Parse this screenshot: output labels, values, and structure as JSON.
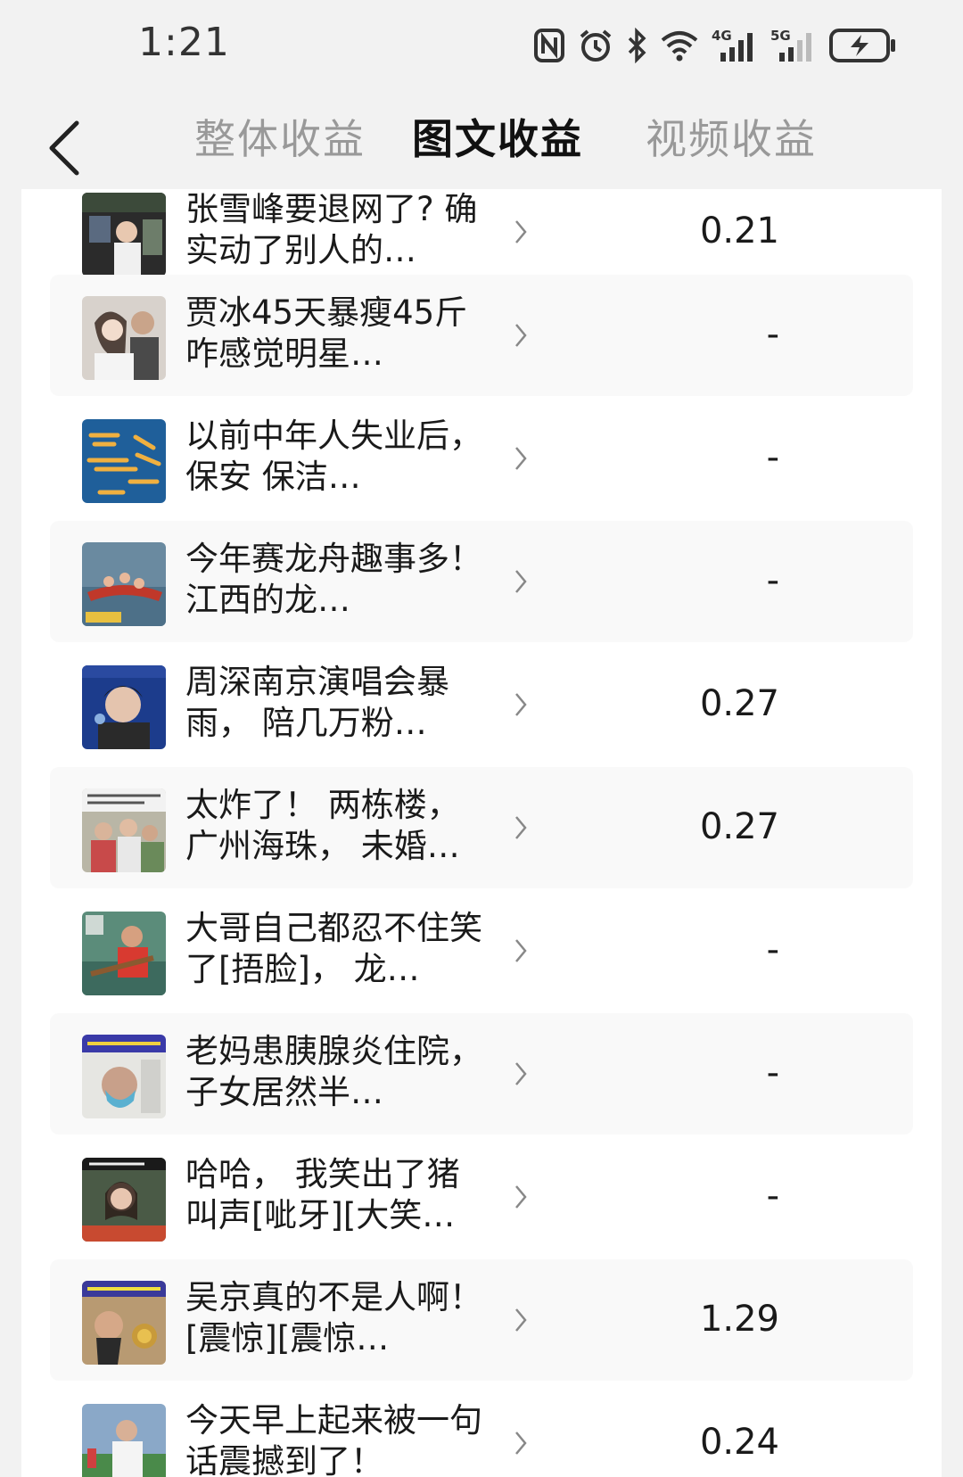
{
  "status_bar": {
    "time": "1:21",
    "icons": [
      "nfc-icon",
      "alarm-icon",
      "bluetooth-icon",
      "wifi-icon",
      "signal-4g-icon",
      "signal-5g-icon",
      "battery-charging-icon"
    ],
    "network_labels": {
      "first": "4G",
      "second": "5G"
    }
  },
  "header": {
    "back_icon": "chevron-left-icon",
    "tabs": [
      {
        "label": "整体收益",
        "active": false
      },
      {
        "label": "图文收益",
        "active": true
      },
      {
        "label": "视频收益",
        "active": false
      }
    ]
  },
  "colors": {
    "background": "#f2f2f2",
    "panel": "#ffffff",
    "tab_inactive": "#999999",
    "tab_active": "#111111"
  },
  "articles": [
    {
      "title": "张雪峰要退网了? 确实动了别人的…",
      "value": "0.21"
    },
    {
      "title": "贾冰45天暴瘦45斤 咋感觉明星…",
      "value": "-"
    },
    {
      "title": "以前中年人失业后， 保安 保洁…",
      "value": "-"
    },
    {
      "title": "今年赛龙舟趣事多！ 江西的龙…",
      "value": "-"
    },
    {
      "title": "周深南京演唱会暴雨， 陪几万粉…",
      "value": "0.27"
    },
    {
      "title": "太炸了！ 两栋楼， 广州海珠， 未婚…",
      "value": "0.27"
    },
    {
      "title": "大哥自己都忍不住笑了[捂脸]， 龙…",
      "value": "-"
    },
    {
      "title": "老妈患胰腺炎住院， 子女居然半…",
      "value": "-"
    },
    {
      "title": "哈哈， 我笑出了猪叫声[呲牙][大笑…",
      "value": "-"
    },
    {
      "title": "吴京真的不是人啊！ [震惊][震惊…",
      "value": "1.29"
    },
    {
      "title": "今天早上起来被一句话震撼到了！",
      "value": "0.24"
    }
  ]
}
